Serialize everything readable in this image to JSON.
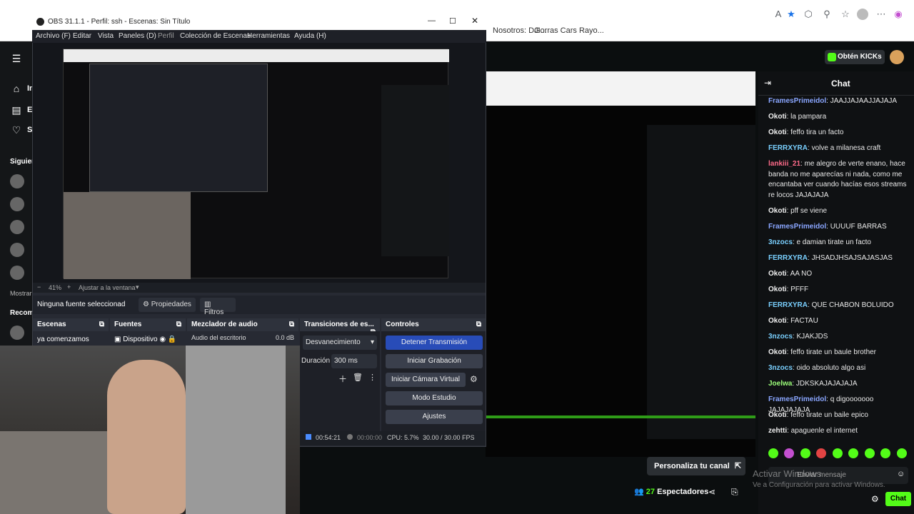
{
  "browser": {
    "bookmark_1": "Nosotros: DJI...",
    "bookmark_2": "Gorras Cars Rayo..."
  },
  "kick": {
    "get_kicks_label": "Obtén KICKs",
    "nav_labels": [
      "In",
      "E",
      "S"
    ],
    "following_label": "Siguien",
    "show_more_label": "Mostrar",
    "recommended_label": "Recom",
    "customize_channel_label": "Personaliza tu canal",
    "viewers_count": "27",
    "viewers_label": "Espectadores",
    "send_message_placeholder": "Enviar mensaje",
    "chat_button_label": "Chat",
    "activate_windows_title": "Activar Windows",
    "activate_windows_subtitle": "Ve a Configuración para activar Windows."
  },
  "chat": {
    "title": "Chat",
    "messages": [
      {
        "user": "FramesPrimeidol",
        "text": ": JAAJJAJAAJJAJAJA",
        "color": "#8aa6ff"
      },
      {
        "user": "Okoti",
        "text": ": la pampara",
        "color": "#f0f0f0"
      },
      {
        "user": "Okoti",
        "text": ": feffo tira un facto",
        "color": "#f0f0f0"
      },
      {
        "user": "FERRXYRA",
        "text": ": volve a milanesa craft",
        "color": "#7ad0ff"
      },
      {
        "user": "lankiii_21",
        "text": ": me alegro de verte enano, hace banda no me aparecías ni nada, como me encantaba ver cuando hacías esos streams re locos JAJAJAJA",
        "color": "#ff6b8a"
      },
      {
        "user": "Okoti",
        "text": ": pff se viene",
        "color": "#f0f0f0"
      },
      {
        "user": "FramesPrimeidol",
        "text": ": UUUUF BARRAS",
        "color": "#8aa6ff"
      },
      {
        "user": "3nzocs",
        "text": ": e damian tirate un facto",
        "color": "#7ad0ff"
      },
      {
        "user": "FERRXYRA",
        "text": ": JHSADJHSAJSAJASJAS",
        "color": "#7ad0ff"
      },
      {
        "user": "Okoti",
        "text": ": AA NO",
        "color": "#f0f0f0"
      },
      {
        "user": "Okoti",
        "text": ": PFFF",
        "color": "#f0f0f0"
      },
      {
        "user": "FERRXYRA",
        "text": ": QUE CHABON BOLUIDO",
        "color": "#7ad0ff"
      },
      {
        "user": "Okoti",
        "text": ": FACTAU",
        "color": "#f0f0f0"
      },
      {
        "user": "3nzocs",
        "text": ": KJAKJDS",
        "color": "#7ad0ff"
      },
      {
        "user": "Okoti",
        "text": ": feffo tirate un baule brother",
        "color": "#f0f0f0"
      },
      {
        "user": "3nzocs",
        "text": ": oido absoluto algo asi",
        "color": "#7ad0ff"
      },
      {
        "user": "Joelwa",
        "text": ": JDKSKAJAJAJAJA",
        "color": "#9cff7a"
      },
      {
        "user": "FramesPrimeidol",
        "text": ": q digooooooo JAJAJAJAJA",
        "color": "#8aa6ff"
      },
      {
        "user": "Okoti",
        "text": ": feffo tirate un baile epico",
        "color": "#f0f0f0"
      },
      {
        "user": "zehtti",
        "text": ": apaguenle el internet",
        "color": "#f0f0f0"
      }
    ]
  },
  "obs": {
    "title": "OBS 31.1.1 - Perfil: ssh - Escenas: Sin Título",
    "menu": [
      "Archivo (F)",
      "Editar",
      "Vista",
      "Paneles (D)",
      "Perfil",
      "Colección de Escenas",
      "Herramientas",
      "Ayuda (H)"
    ],
    "zoom_label": "41%",
    "fit_label": "Ajustar a la ventana",
    "no_source_label": "Ninguna fuente seleccionad",
    "properties_label": "Propiedades",
    "filters_label": "Filtros",
    "scenes_title": "Escenas",
    "scene_item": "ya comenzamos",
    "sources_title": "Fuentes",
    "source_item": "Dispositivo",
    "mixer_title": "Mezclador de audio",
    "mixer_item": "Audio del escritorio",
    "mixer_db": "0.0 dB",
    "transitions_title": "Transiciones de es...",
    "transition_value": "Desvanecimiento",
    "duration_label": "Duración",
    "duration_value": "300 ms",
    "controls_title": "Controles",
    "btn_stop_stream": "Detener Transmisión",
    "btn_record": "Iniciar Grabación",
    "btn_virtual_cam": "Iniciar Cámara Virtual",
    "btn_studio": "Modo Estudio",
    "btn_settings": "Ajustes",
    "status_stream_time": "00:54:21",
    "status_rec_time": "00:00:00",
    "status_cpu": "CPU: 5.7%",
    "status_fps": "30.00 / 30.00 FPS"
  },
  "colors": {
    "kick_green": "#53fc18",
    "obs_primary_button": "#284cb8"
  }
}
